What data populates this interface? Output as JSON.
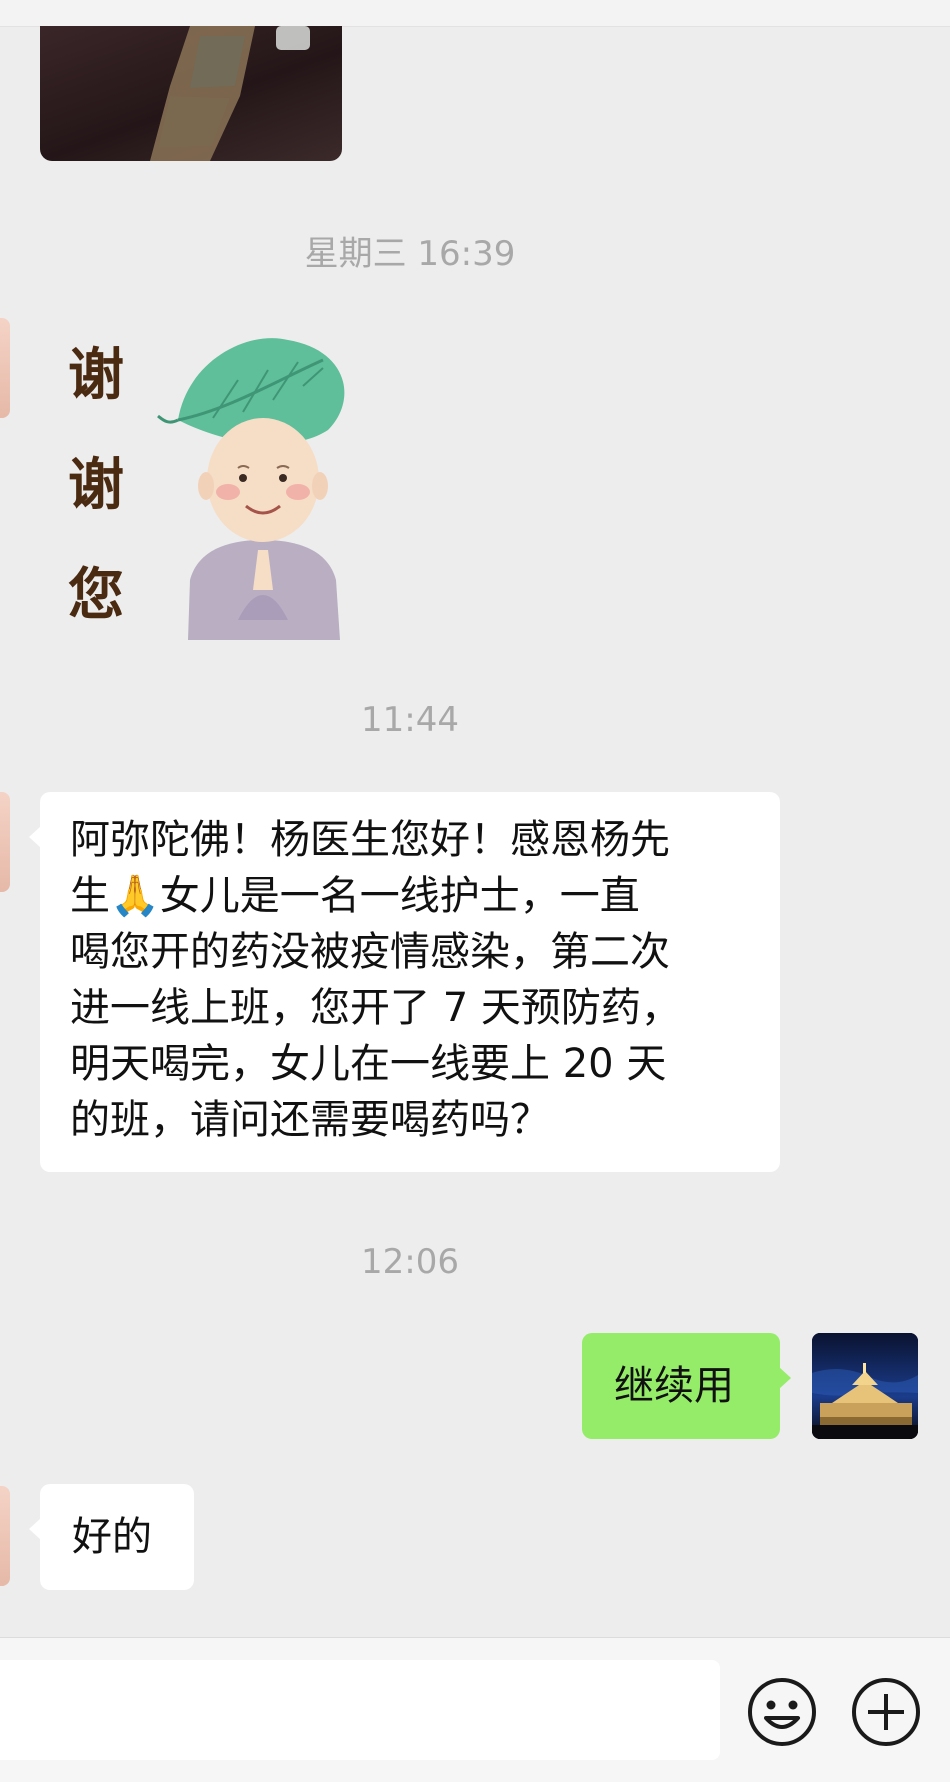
{
  "chat": {
    "timestamp_1": "星期三 16:39",
    "sticker_text": [
      "谢",
      "谢",
      "您"
    ],
    "timestamp_2": "11:44",
    "incoming_message_lines": [
      "阿弥陀佛！杨医生您好！感恩杨先",
      "生🙏女儿是一名一线护士，一直",
      "喝您开的药没被疫情感染，第二次",
      "进一线上班，您开了 7 天预防药，",
      "明天喝完，女儿在一线要上 20 天",
      "的班，请问还需要喝药吗？"
    ],
    "timestamp_3": "12:06",
    "outgoing_message": "继续用",
    "incoming_reply": "好的"
  },
  "input_bar": {
    "value": "",
    "emoji_icon": "smiley-face-icon",
    "plus_icon": "plus-circle-icon"
  },
  "colors": {
    "background": "#ededed",
    "incoming_bubble": "#ffffff",
    "outgoing_bubble": "#95ec69",
    "timestamp": "#a8a8a8"
  }
}
